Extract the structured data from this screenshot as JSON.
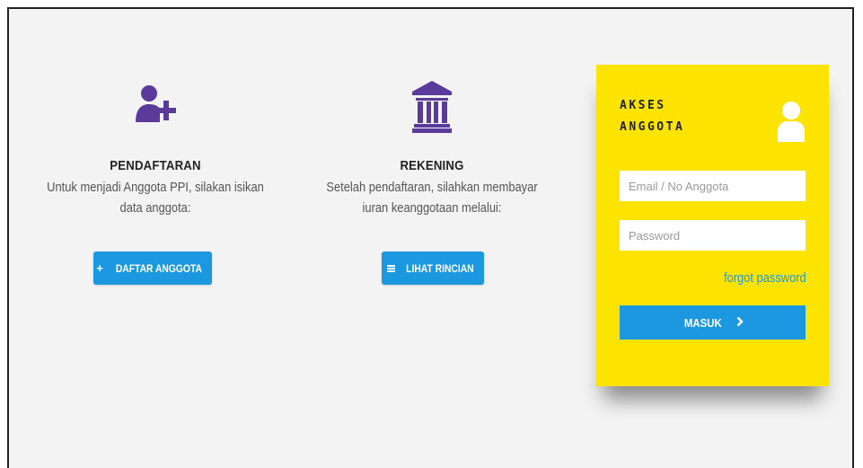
{
  "colors": {
    "accent_blue": "#1b98e0",
    "icon_purple": "#5a3a9a",
    "panel_yellow": "#fde400"
  },
  "registration": {
    "icon": "user-plus-icon",
    "title": "PENDAFTARAN",
    "description": "Untuk menjadi Anggota PPI, silakan isikan data anggota:",
    "button_label": "DAFTAR ANGGOTA",
    "button_icon": "plus-icon"
  },
  "account": {
    "icon": "bank-icon",
    "title": "REKENING",
    "description": "Setelah pendaftaran, silahkan membayar iuran keanggotaan melalui:",
    "button_label": "LIHAT RINCIAN",
    "button_icon": "list-icon"
  },
  "member_access": {
    "title": "AKSES ANGGOTA",
    "icon": "user-icon",
    "email_placeholder": "Email / No Anggota",
    "email_value": "",
    "password_placeholder": "Password",
    "password_value": "",
    "forgot_label": "forgot password",
    "submit_label": "MASUK",
    "submit_icon": "chevron-right-icon"
  }
}
